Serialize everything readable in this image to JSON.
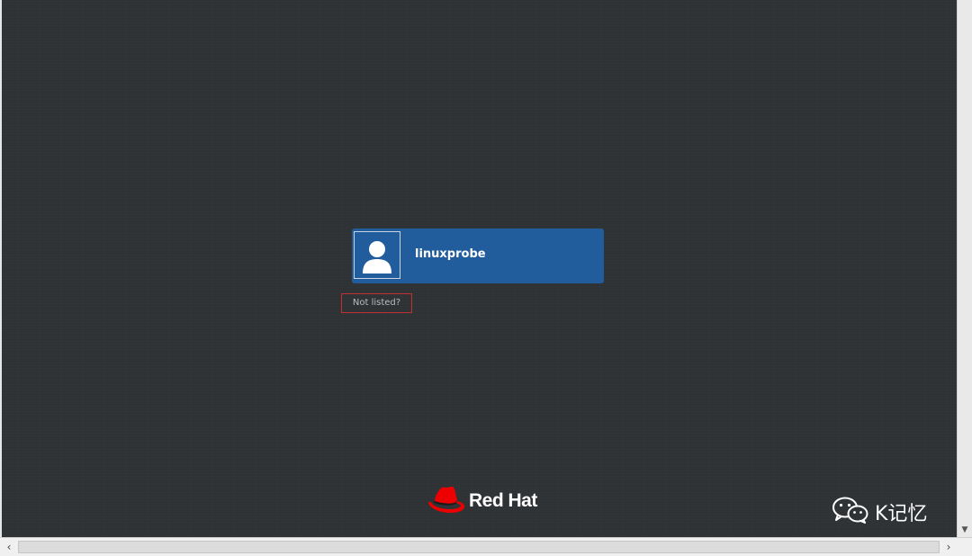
{
  "login": {
    "user_card": {
      "username": "linuxprobe"
    },
    "not_listed_label": "Not listed?"
  },
  "branding": {
    "logo_text": "Red Hat"
  },
  "watermark": {
    "text": "K记忆"
  },
  "icons": {
    "avatar": "user-avatar-icon",
    "logo": "redhat-hat-icon",
    "watermark": "wechat-icon",
    "scroll_left": "chevron-left-icon",
    "scroll_right": "chevron-right-icon",
    "scroll_down": "chevron-down-icon"
  },
  "colors": {
    "background": "#2f3235",
    "user_card": "#215d9c",
    "highlight_box": "#c03030",
    "brand_red": "#ee0000"
  }
}
